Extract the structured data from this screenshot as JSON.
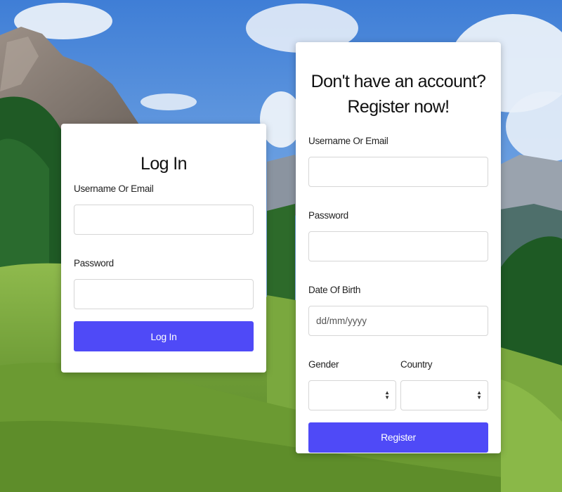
{
  "colors": {
    "accent": "#4f4af7",
    "card_background": "#ffffff",
    "input_border": "#d6d6d6"
  },
  "login": {
    "title": "Log In",
    "username_label": "Username Or Email",
    "username_value": "",
    "password_label": "Password",
    "password_value": "",
    "submit_label": "Log In"
  },
  "register": {
    "title": "Don't have an account? Register now!",
    "username_label": "Username Or Email",
    "username_value": "",
    "password_label": "Password",
    "password_value": "",
    "dob_label": "Date Of Birth",
    "dob_placeholder": "dd/mm/yyyy",
    "gender_label": "Gender",
    "gender_value": "",
    "country_label": "Country",
    "country_value": "",
    "submit_label": "Register"
  },
  "icons": {
    "select_arrow": "updown-chevron-icon"
  }
}
